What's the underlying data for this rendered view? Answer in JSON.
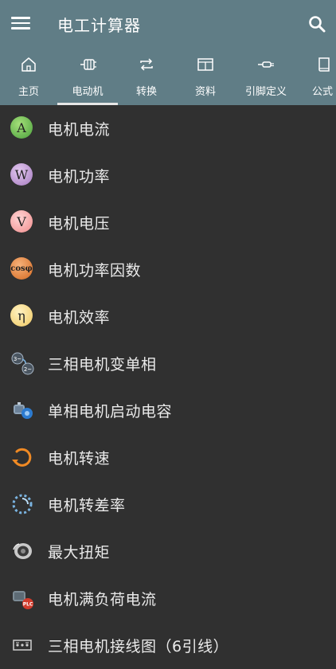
{
  "app": {
    "title": "电工计算器",
    "colors": {
      "appbar": "#607d86",
      "background": "#303030",
      "text": "#eaeaea"
    }
  },
  "tabs": [
    {
      "label": "主页",
      "icon": "home-icon",
      "active": false
    },
    {
      "label": "电动机",
      "icon": "motor-icon",
      "active": true
    },
    {
      "label": "转换",
      "icon": "convert-icon",
      "active": false
    },
    {
      "label": "资料",
      "icon": "table-icon",
      "active": false
    },
    {
      "label": "引脚定义",
      "icon": "connector-icon",
      "active": false
    },
    {
      "label": "公式",
      "icon": "book-icon",
      "active": false
    }
  ],
  "items": [
    {
      "label": "电机电流",
      "icon": "current-A-icon",
      "glyph": "A"
    },
    {
      "label": "电机功率",
      "icon": "power-W-icon",
      "glyph": "W"
    },
    {
      "label": "电机电压",
      "icon": "voltage-V-icon",
      "glyph": "V"
    },
    {
      "label": "电机功率因数",
      "icon": "cos-phi-icon",
      "glyph": "cosφ"
    },
    {
      "label": "电机效率",
      "icon": "efficiency-eta-icon",
      "glyph": "η"
    },
    {
      "label": "三相电机变单相",
      "icon": "phase-convert-icon"
    },
    {
      "label": "单相电机启动电容",
      "icon": "capacitor-motor-icon"
    },
    {
      "label": "电机转速",
      "icon": "rotation-speed-icon"
    },
    {
      "label": "电机转差率",
      "icon": "slip-rate-icon"
    },
    {
      "label": "最大扭矩",
      "icon": "torque-icon"
    },
    {
      "label": "电机满负荷电流",
      "icon": "full-load-plc-icon",
      "badge": "PLC"
    },
    {
      "label": "三相电机接线图（6引线）",
      "icon": "wiring-diagram-icon"
    }
  ]
}
